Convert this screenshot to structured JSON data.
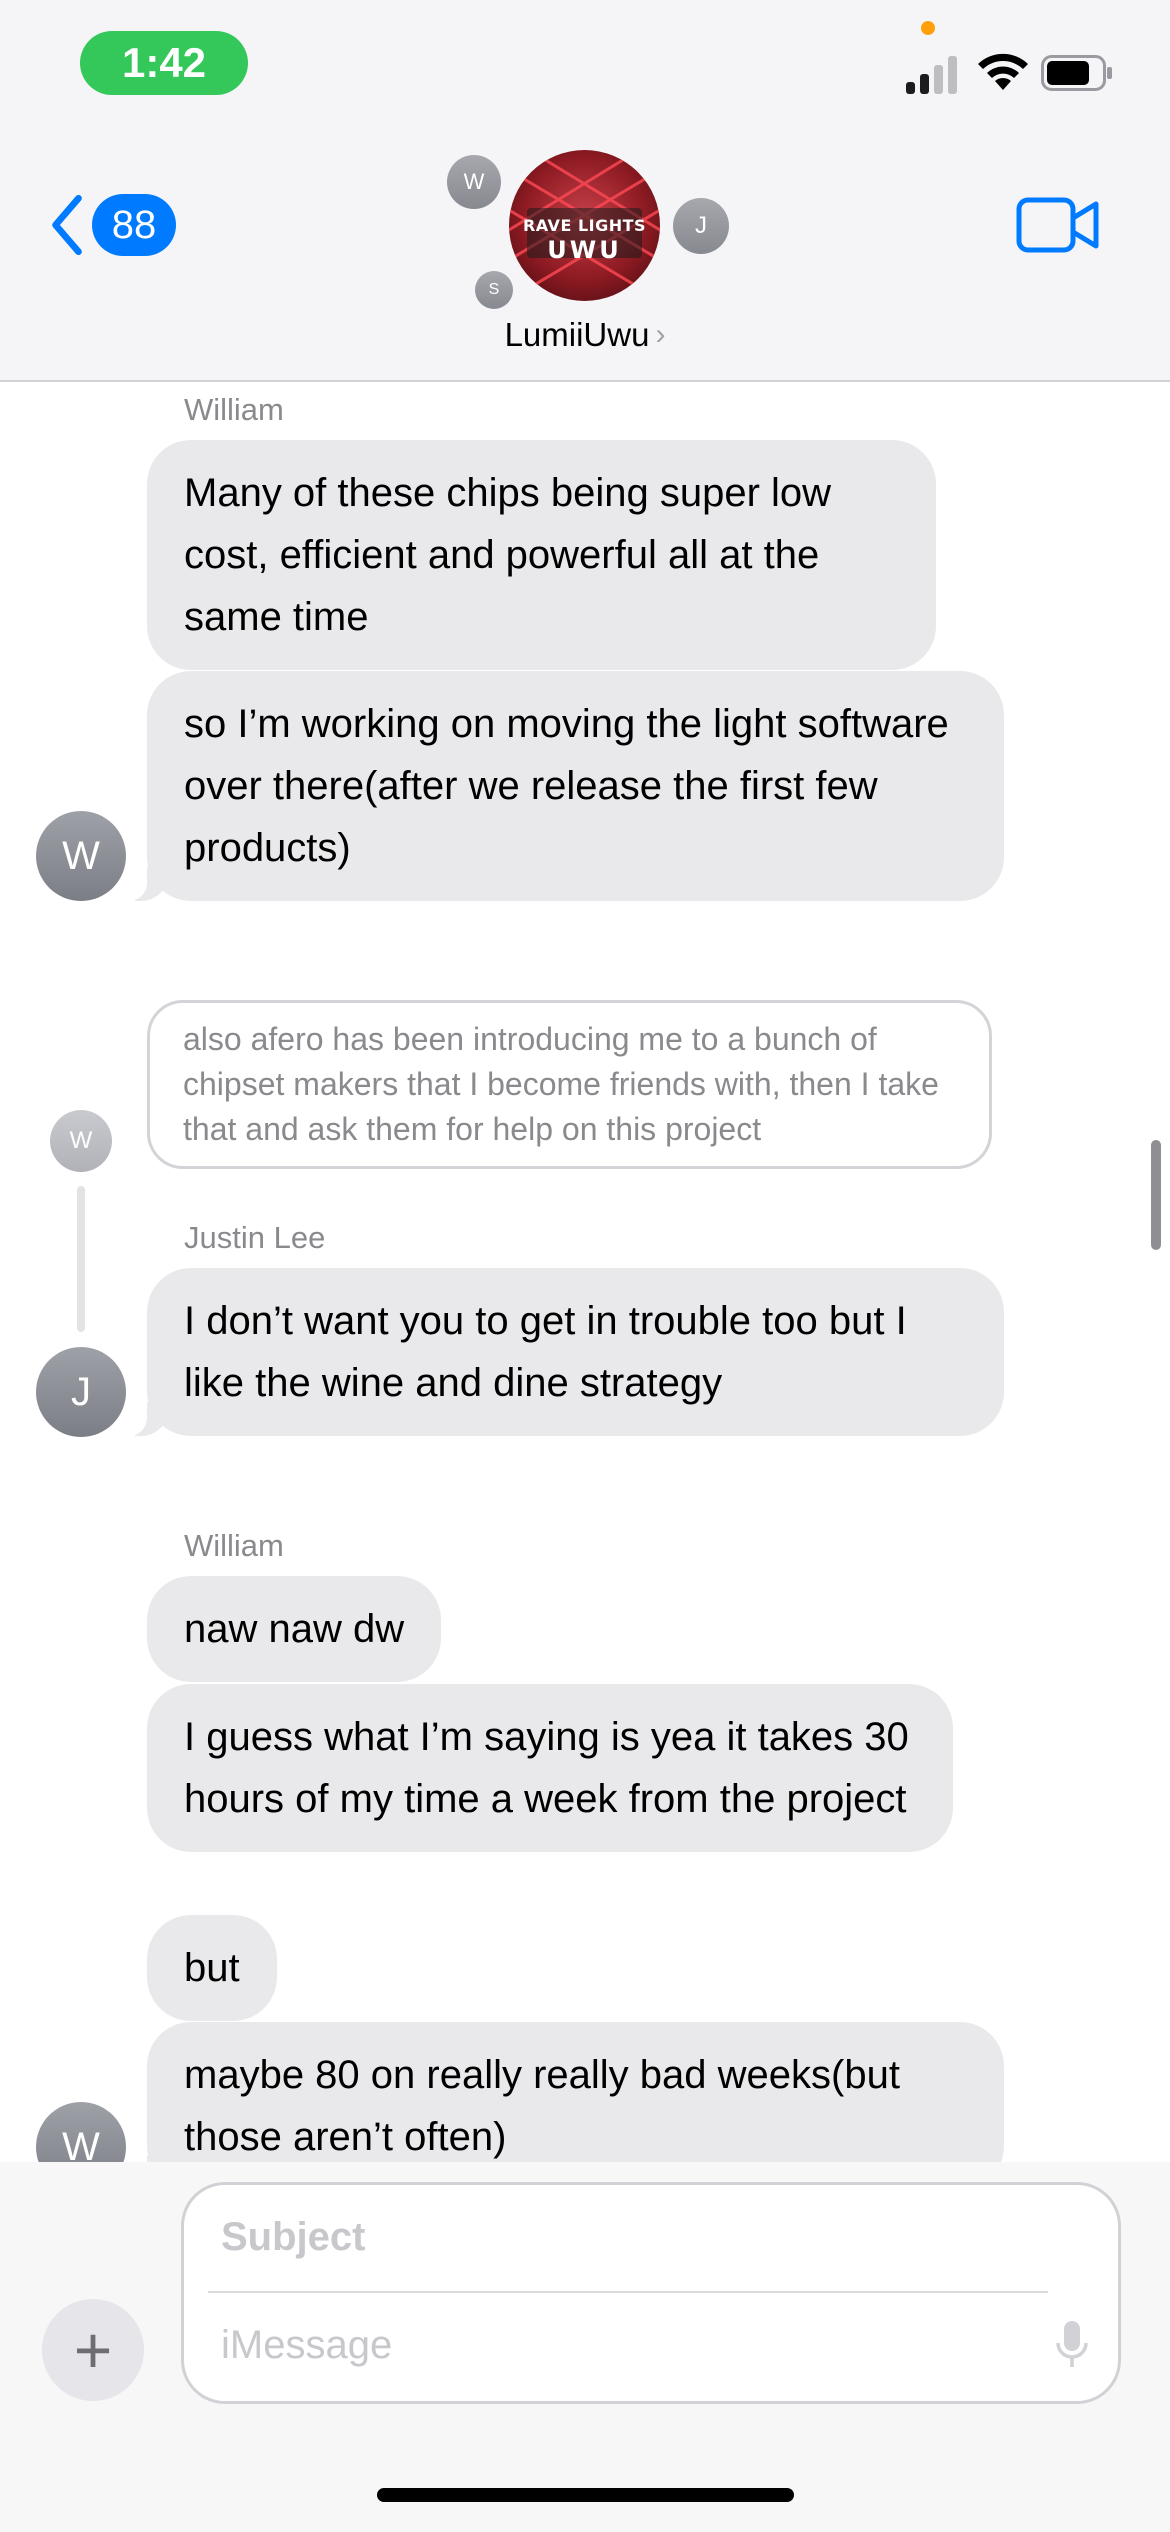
{
  "status_bar": {
    "time": "1:42"
  },
  "header": {
    "back_count": "88",
    "group_name": "LumiiUwu",
    "group_name_chevron": "›",
    "avatar_logo_top": "RAVE LIGHTS",
    "avatar_logo_bottom": "UWU",
    "participant_initials": [
      "W",
      "J",
      "S"
    ],
    "video_icon": "video-camera-icon"
  },
  "messages": {
    "sender_1": "William",
    "m1": "Many of these chips being super low cost, efficient and powerful all at the same time",
    "m2": "so I’m working on moving the light software over there(after we release the first few products)",
    "avatar_1": "W",
    "reply_quote": "also afero has been introducing me to a bunch of chipset makers that I become friends with, then I take that and ask them for help on this project",
    "reply_avatar": "W",
    "sender_2": "Justin Lee",
    "m3": "I don’t want you to get in trouble too but I like the wine and dine strategy",
    "avatar_2": "J",
    "sender_3": "William",
    "m4": "naw naw dw",
    "m5": "I guess what I’m saying is yea it takes 30 hours of my time a week from the project",
    "m6": "but",
    "m7": "maybe 80 on really really bad weeks(but those aren’t often)",
    "avatar_3": "W"
  },
  "composer": {
    "plus": "+",
    "subject_placeholder": "Subject",
    "message_placeholder": "iMessage"
  },
  "colors": {
    "accent": "#007aff",
    "time_pill": "#34c759",
    "bubble_received": "#e9e9eb"
  }
}
